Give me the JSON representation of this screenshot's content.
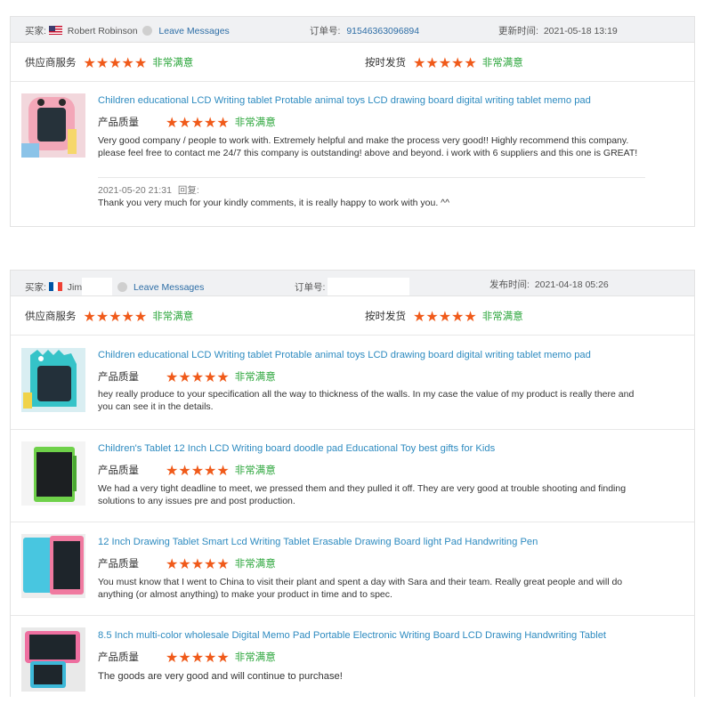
{
  "reviews": [
    {
      "buyer_label": "买家:",
      "buyer_name": "Robert Robinson",
      "buyer_flag": "us-flag",
      "leave_messages": "Leave Messages",
      "order_label": "订单号:",
      "order_no": "91546363096894",
      "time_label": "更新时间:",
      "time_value": "2021-05-18 13:19",
      "service_label": "供应商服务",
      "service_rating": "非常满意",
      "delivery_label": "按时发货",
      "delivery_rating": "非常满意",
      "stars": "★★★★★",
      "products": [
        {
          "title": "Children educational LCD Writing tablet Protable animal toys LCD drawing board digital writing tablet memo pad",
          "quality_label": "产品质量",
          "quality_rating": "非常满意",
          "comment": "Very good company / people to work with. Extremely helpful and make the process very good!! Highly recommend this company. please feel free to contact me 24/7 this company is outstanding! above and beyond. i work with 6 suppliers and this one is GREAT!",
          "reply_date": "2021-05-20 21:31",
          "reply_label": "回复:",
          "reply_text": "Thank you very much for your kindly comments, it is really happy to work with you. ^^"
        }
      ]
    },
    {
      "buyer_label": "买家:",
      "buyer_name": "Jim",
      "buyer_flag": "fr-flag",
      "leave_messages": "Leave Messages",
      "order_label": "订单号:",
      "time_label": "发布时间:",
      "time_value": "2021-04-18 05:26",
      "service_label": "供应商服务",
      "service_rating": "非常满意",
      "delivery_label": "按时发货",
      "delivery_rating": "非常满意",
      "stars": "★★★★★",
      "products": [
        {
          "title": "Children educational LCD Writing tablet Protable animal toys LCD drawing board digital writing tablet memo pad",
          "quality_label": "产品质量",
          "quality_rating": "非常满意",
          "comment": "hey really produce to your specification all the way to thickness of the walls. In my case the value of my product is really there and you can see it in the details."
        },
        {
          "title": "Children's Tablet 12 Inch LCD Writing board doodle pad Educational Toy best gifts for Kids",
          "quality_label": "产品质量",
          "quality_rating": "非常满意",
          "comment": "We had a very tight deadline to meet, we pressed them and they pulled it off. They are very good at trouble shooting and finding solutions to any issues pre and post production."
        },
        {
          "title": "12 Inch Drawing Tablet Smart Lcd Writing Tablet Erasable Drawing Board light Pad Handwriting Pen",
          "quality_label": "产品质量",
          "quality_rating": "非常满意",
          "comment": "You must know that I went to China to visit their plant and spent a day with Sara and their team. Really great people and will do anything (or almost anything) to make your product in time and to spec."
        },
        {
          "title": "8.5 Inch multi-color wholesale Digital Memo Pad Portable Electronic Writing Board LCD Drawing Handwriting Tablet",
          "quality_label": "产品质量",
          "quality_rating": "非常满意",
          "comment": "The goods are very good and will continue to purchase!"
        }
      ]
    }
  ],
  "colors": {
    "star": "#f05a1a",
    "rating_text": "#2aa53a",
    "link": "#2e6ea6",
    "product_title": "#2e8bc0"
  }
}
